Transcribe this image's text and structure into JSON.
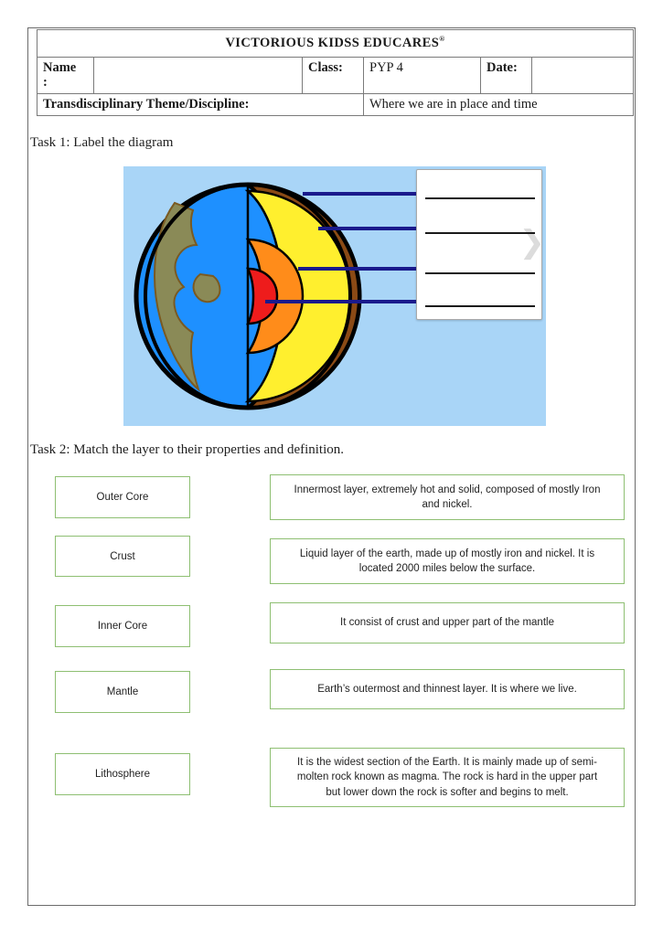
{
  "header": {
    "school_title": "VICTORIOUS KIDSS EDUCARES",
    "trademark": "®",
    "name_label": "Name\n:",
    "name_value": "",
    "class_label": "Class:",
    "class_value": "PYP 4",
    "date_label": "Date:",
    "date_value": "",
    "theme_label": "Transdisciplinary Theme/Discipline:",
    "theme_value": "Where we are in place and time"
  },
  "task1": {
    "heading": "Task 1: Label the diagram",
    "diagram": {
      "name": "earth-cross-section",
      "background_color": "#a9d5f7",
      "layers": [
        {
          "name": "ocean",
          "color": "#1e90ff"
        },
        {
          "name": "land",
          "color": "#8a8a57"
        },
        {
          "name": "crust",
          "color": "#8b4a15"
        },
        {
          "name": "mantle",
          "color": "#ffef2e"
        },
        {
          "name": "outer-core",
          "color": "#ff8c1a"
        },
        {
          "name": "inner-core",
          "color": "#ee1c1c"
        }
      ],
      "pointer_color": "#1a1a8c",
      "pointer_count": 4,
      "answer_lines": 4
    }
  },
  "task2": {
    "heading": "Task 2: Match the layer to their properties and definition.",
    "layers": [
      {
        "label": "Outer Core"
      },
      {
        "label": "Crust"
      },
      {
        "label": "Inner Core"
      },
      {
        "label": "Mantle"
      },
      {
        "label": "Lithosphere"
      }
    ],
    "definitions": [
      {
        "lines": [
          "Innermost layer, extremely hot and solid, composed of mostly Iron",
          "and nickel."
        ]
      },
      {
        "lines": [
          "Liquid layer of the earth, made up of mostly iron and nickel. It is",
          "located 2000 miles below the surface."
        ]
      },
      {
        "lines": [
          "It consist of crust and upper part of the mantle"
        ]
      },
      {
        "lines": [
          "Earth’s outermost and thinnest layer. It is where we live."
        ]
      },
      {
        "lines": [
          "It is the widest section of the Earth.  It is mainly made up of semi-",
          "molten rock known as magma. The rock is hard in the upper part",
          "but lower down the rock is softer and begins to melt."
        ]
      }
    ]
  }
}
